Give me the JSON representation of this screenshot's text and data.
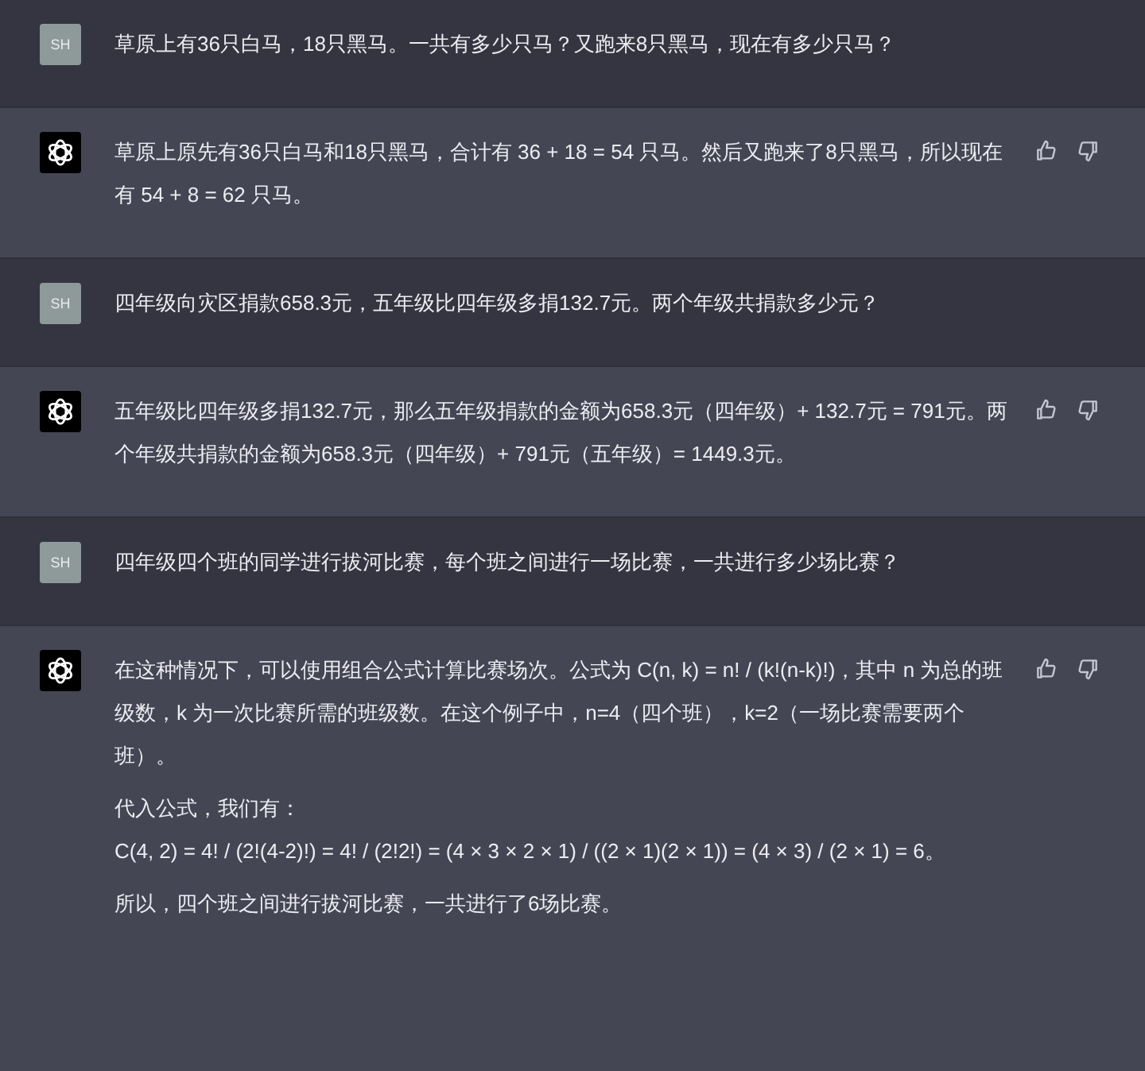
{
  "messages": [
    {
      "kind": "user",
      "avatar": "SH",
      "paragraphs": [
        [
          "草原上有36只白马，18只黑马。一共有多少只马？又跑来8只黑马，现在有多少只马？"
        ]
      ]
    },
    {
      "kind": "assistant",
      "paragraphs": [
        [
          "草原上原先有36只白马和18只黑马，合计有 36 + 18 = 54 只马。然后又跑来了8只黑马，所以现在有 54 + 8 = 62 只马。"
        ]
      ]
    },
    {
      "kind": "user",
      "avatar": "SH",
      "paragraphs": [
        [
          "四年级向灾区捐款658.3元，五年级比四年级多捐132.7元。两个年级共捐款多少元？"
        ]
      ]
    },
    {
      "kind": "assistant",
      "paragraphs": [
        [
          "五年级比四年级多捐132.7元，那么五年级捐款的金额为658.3元（四年级）+ 132.7元 = 791元。两个年级共捐款的金额为658.3元（四年级）+ 791元（五年级）= 1449.3元。"
        ]
      ]
    },
    {
      "kind": "user",
      "avatar": "SH",
      "paragraphs": [
        [
          "四年级四个班的同学进行拔河比赛，每个班之间进行一场比赛，一共进行多少场比赛？"
        ]
      ]
    },
    {
      "kind": "assistant",
      "paragraphs": [
        [
          "在这种情况下，可以使用组合公式计算比赛场次。公式为 C(n, k) = n! / (k!(n-k)!)，其中 n 为总的班级数，k 为一次比赛所需的班级数。在这个例子中，n=4（四个班），k=2（一场比赛需要两个班）。"
        ],
        [
          "代入公式，我们有：",
          "C(4, 2) = 4! / (2!(4-2)!) = 4! / (2!2!) = (4 × 3 × 2 × 1) / ((2 × 1)(2 × 1)) = (4 × 3) / (2 × 1) = 6。"
        ],
        [
          "所以，四个班之间进行拔河比赛，一共进行了6场比赛。"
        ]
      ]
    }
  ]
}
